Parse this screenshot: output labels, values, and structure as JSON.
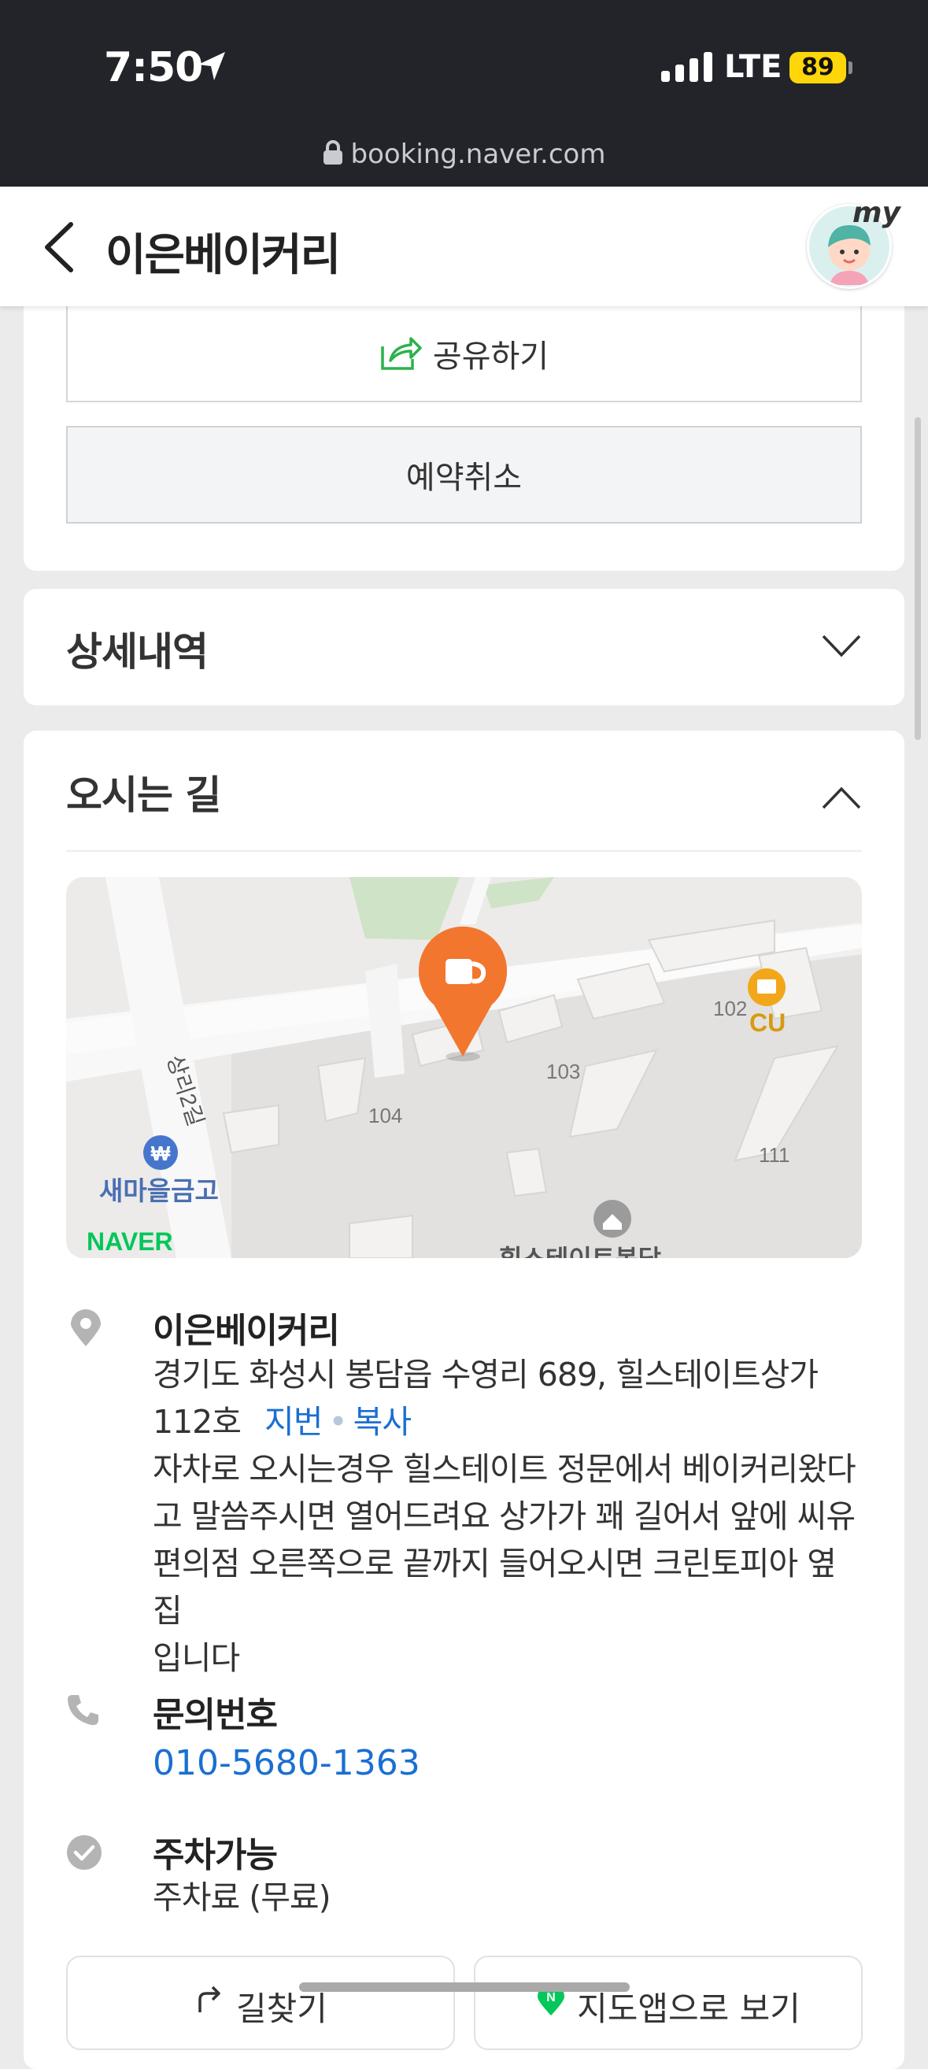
{
  "status_bar": {
    "time": "7:50",
    "network": "LTE",
    "battery": "89"
  },
  "browser": {
    "url": "booking.naver.com"
  },
  "header": {
    "title": "이은베이커리",
    "profile_label": "my"
  },
  "actions": {
    "share": "공유하기",
    "cancel": "예약취소"
  },
  "sections": {
    "details": {
      "title": "상세내역"
    },
    "directions": {
      "title": "오시는 길"
    }
  },
  "map": {
    "road": "상리2길",
    "bank": "새마을금고",
    "store": "CU",
    "building_numbers": [
      "102",
      "103",
      "104",
      "111"
    ],
    "bottom_label": "힐스테이트봉담",
    "brand": "NAVER"
  },
  "place": {
    "name": "이은베이커리",
    "address_line1": "경기도 화성시 봉담읍 수영리 689, 힐스테이트상가",
    "address_line2": "112호",
    "jibun_link": "지번",
    "copy_link": "복사",
    "directions_note": [
      "자차로 오시는경우 힐스테이트 정문에서 베이커리왔다",
      "고 말씀주시면 열어드려요 상가가 꽤 길어서 앞에 씨유",
      "편의점 오른쪽으로 끝까지 들어오시면 크린토피아 옆집",
      "입니다"
    ]
  },
  "contact": {
    "label": "문의번호",
    "phone": "010-5680-1363"
  },
  "parking": {
    "label": "주차가능",
    "fee": "주차료 (무료)"
  },
  "bottom_buttons": {
    "route": "길찾기",
    "map_app": "지도앱으로 보기"
  },
  "colors": {
    "pin": "#f2762e",
    "link": "#1a6fd1",
    "naver_green": "#03c75a",
    "battery": "#ffd60a"
  }
}
